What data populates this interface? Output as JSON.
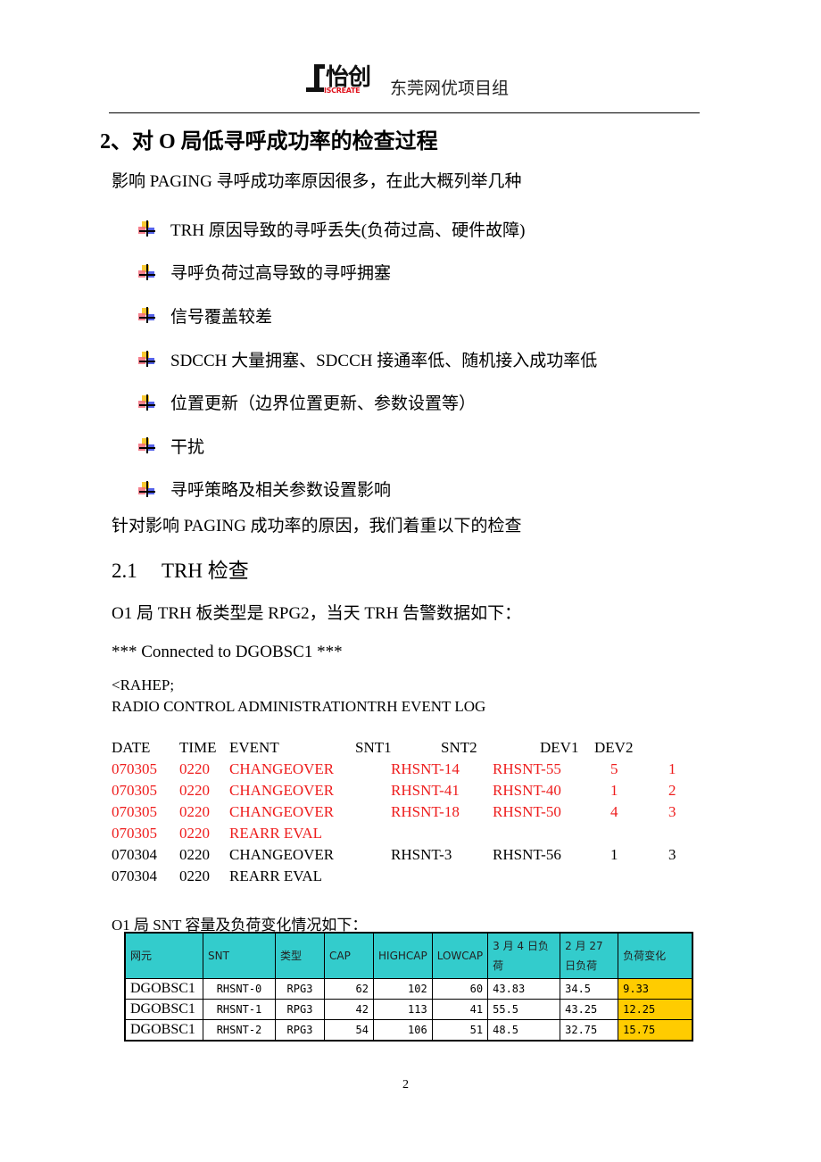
{
  "header": {
    "logo_cn": "怡创",
    "logo_en": "ISCREATE",
    "group_title": "东莞网优项目组"
  },
  "section": {
    "title": "2、对 O 局低寻呼成功率的检查过程",
    "intro": "影响 PAGING 寻呼成功率原因很多，在此大概列举几种",
    "bullets": [
      "TRH 原因导致的寻呼丢失(负荷过高、硬件故障)",
      "寻呼负荷过高导致的寻呼拥塞",
      "信号覆盖较差",
      "SDCCH 大量拥塞、SDCCH 接通率低、随机接入成功率低",
      "位置更新（边界位置更新、参数设置等）",
      "干扰",
      "寻呼策略及相关参数设置影响"
    ],
    "outro": "针对影响 PAGING 成功率的原因，我们着重以下的检查"
  },
  "subsection": {
    "number": "2.1",
    "title": "TRH 检查",
    "description": "O1 局 TRH 板类型是 RPG2，当天 TRH 告警数据如下："
  },
  "log": {
    "connected": "*** Connected to DGOBSC1 ***",
    "command": "<RAHEP;",
    "report_title": "RADIO CONTROL ADMINISTRATIONTRH EVENT LOG",
    "columns": [
      "DATE",
      "TIME",
      "EVENT",
      "SNT1",
      "SNT2",
      "DEV1",
      "DEV2"
    ],
    "rows": [
      {
        "date": "070305",
        "time": "0220",
        "event": "CHANGEOVER",
        "snt1": "RHSNT-14",
        "snt2": "RHSNT-55",
        "dev1": "5",
        "dev2": "1",
        "highlight": true
      },
      {
        "date": "070305",
        "time": "0220",
        "event": "CHANGEOVER",
        "snt1": "RHSNT-41",
        "snt2": "RHSNT-40",
        "dev1": "1",
        "dev2": "2",
        "highlight": true
      },
      {
        "date": "070305",
        "time": "0220",
        "event": "CHANGEOVER",
        "snt1": "RHSNT-18",
        "snt2": "RHSNT-50",
        "dev1": "4",
        "dev2": "3",
        "highlight": true
      },
      {
        "date": "070305",
        "time": "0220",
        "event": "REARR EVAL",
        "snt1": "",
        "snt2": "",
        "dev1": "",
        "dev2": "",
        "highlight": true
      },
      {
        "date": "070304",
        "time": "0220",
        "event": "CHANGEOVER",
        "snt1": "RHSNT-3",
        "snt2": "RHSNT-56",
        "dev1": "1",
        "dev2": "3",
        "highlight": false
      },
      {
        "date": "070304",
        "time": "0220",
        "event": "REARR EVAL",
        "snt1": "",
        "snt2": "",
        "dev1": "",
        "dev2": "",
        "highlight": false
      }
    ],
    "highlight_color": "#ee1c1c"
  },
  "snt_table": {
    "caption": "O1 局 SNT 容量及负荷变化情况如下：",
    "headers": [
      "网元",
      "SNT",
      "类型",
      "CAP",
      "HIGHCAP",
      "LOWCAP",
      "3 月 4 日负荷",
      "2 月 27 日负荷",
      "负荷变化"
    ],
    "rows": [
      [
        "DGOBSC1",
        "RHSNT-0",
        "RPG3",
        "62",
        "102",
        "60",
        "43.83",
        "34.5",
        "9.33"
      ],
      [
        "DGOBSC1",
        "RHSNT-1",
        "RPG3",
        "42",
        "113",
        "41",
        "55.5",
        "43.25",
        "12.25"
      ],
      [
        "DGOBSC1",
        "RHSNT-2",
        "RPG3",
        "54",
        "106",
        "51",
        "48.5",
        "32.75",
        "15.75"
      ]
    ],
    "header_color": "#33cccc",
    "highlight_color": "#ffcc00"
  },
  "footer": {
    "page_number": "2"
  }
}
